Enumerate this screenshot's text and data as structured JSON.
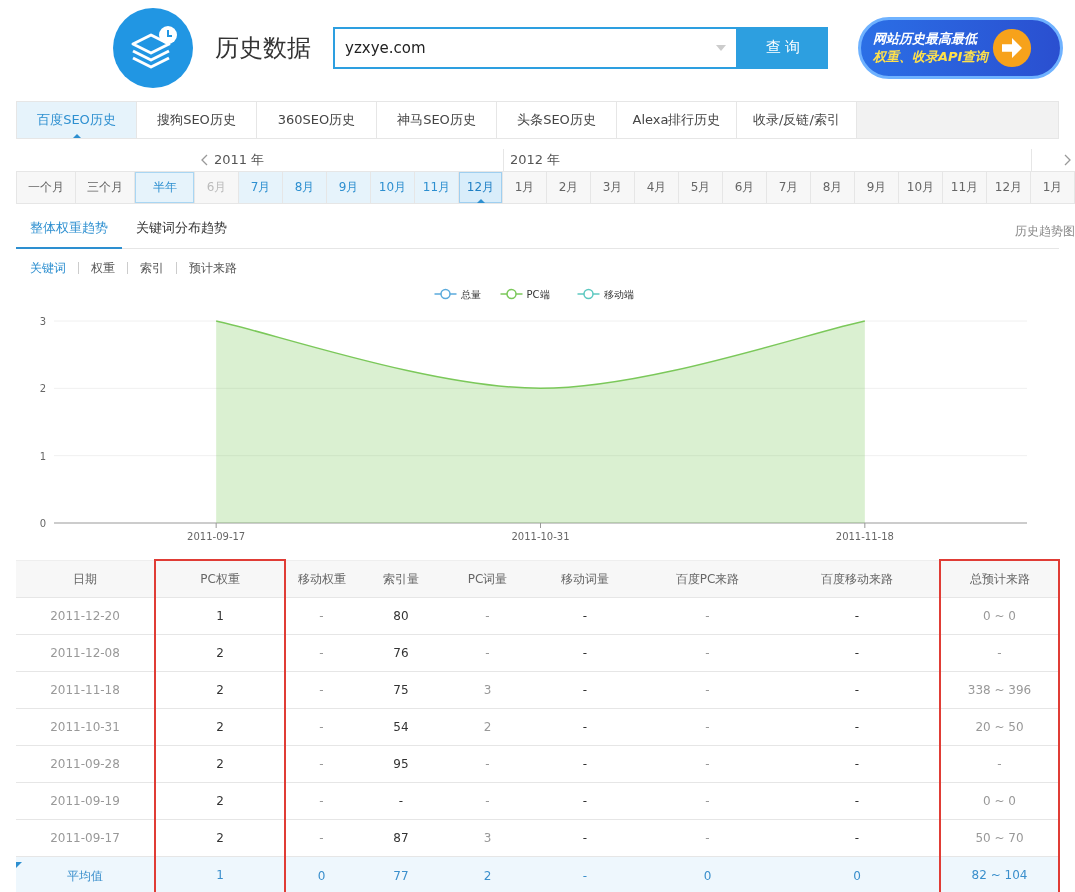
{
  "header": {
    "title": "历史数据",
    "search": {
      "value": "yzxye.com"
    },
    "search_button": "查 询",
    "banner": {
      "line_1": "网站历史最高最低",
      "line_2": "权重、收录API查询"
    }
  },
  "tabs": [
    {
      "label": "百度SEO历史",
      "selected": true
    },
    {
      "label": "搜狗SEO历史",
      "selected": false
    },
    {
      "label": "360SEO历史",
      "selected": false
    },
    {
      "label": "神马SEO历史",
      "selected": false
    },
    {
      "label": "头条SEO历史",
      "selected": false
    },
    {
      "label": "Alexa排行历史",
      "selected": false
    },
    {
      "label": "收录/反链/索引",
      "selected": false
    }
  ],
  "presets": [
    {
      "label": "一个月",
      "selected": false
    },
    {
      "label": "三个月",
      "selected": false
    },
    {
      "label": "半年",
      "selected": true
    }
  ],
  "years": [
    {
      "year": "2011 年",
      "months": [
        {
          "label": "6月",
          "disabled": true,
          "in_range": false,
          "selected": false
        },
        {
          "label": "7月",
          "disabled": false,
          "in_range": true,
          "selected": false
        },
        {
          "label": "8月",
          "disabled": false,
          "in_range": true,
          "selected": false
        },
        {
          "label": "9月",
          "disabled": false,
          "in_range": true,
          "selected": false
        },
        {
          "label": "10月",
          "disabled": false,
          "in_range": true,
          "selected": false
        },
        {
          "label": "11月",
          "disabled": false,
          "in_range": true,
          "selected": false
        },
        {
          "label": "12月",
          "disabled": false,
          "in_range": true,
          "selected": true
        }
      ]
    },
    {
      "year": "2012 年",
      "months": [
        {
          "label": "1月",
          "disabled": false,
          "in_range": false,
          "selected": false
        },
        {
          "label": "2月",
          "disabled": false,
          "in_range": false,
          "selected": false
        },
        {
          "label": "3月",
          "disabled": false,
          "in_range": false,
          "selected": false
        },
        {
          "label": "4月",
          "disabled": false,
          "in_range": false,
          "selected": false
        },
        {
          "label": "5月",
          "disabled": false,
          "in_range": false,
          "selected": false
        },
        {
          "label": "6月",
          "disabled": false,
          "in_range": false,
          "selected": false
        },
        {
          "label": "7月",
          "disabled": false,
          "in_range": false,
          "selected": false
        },
        {
          "label": "8月",
          "disabled": false,
          "in_range": false,
          "selected": false
        },
        {
          "label": "9月",
          "disabled": false,
          "in_range": false,
          "selected": false
        },
        {
          "label": "10月",
          "disabled": false,
          "in_range": false,
          "selected": false
        },
        {
          "label": "11月",
          "disabled": false,
          "in_range": false,
          "selected": false
        },
        {
          "label": "12月",
          "disabled": false,
          "in_range": false,
          "selected": false
        }
      ]
    },
    {
      "months": [
        {
          "label": "1月",
          "disabled": false,
          "in_range": false,
          "selected": false
        }
      ]
    }
  ],
  "trend_tabs": [
    {
      "label": "整体权重趋势",
      "selected": true
    },
    {
      "label": "关键词分布趋势",
      "selected": false
    }
  ],
  "trend_link": "历史趋势图",
  "filters": [
    {
      "label": "关键词",
      "selected": true
    },
    {
      "label": "权重",
      "selected": false
    },
    {
      "label": "索引",
      "selected": false
    },
    {
      "label": "预计来路",
      "selected": false
    }
  ],
  "chart_data": {
    "type": "area",
    "categories": [
      "2011-09-17",
      "2011-10-31",
      "2011-11-18"
    ],
    "series": [
      {
        "name": "总量",
        "color": "#5aaadc",
        "values": [
          null,
          null,
          null
        ]
      },
      {
        "name": "PC端",
        "color": "#7bc85a",
        "values": [
          3,
          2,
          3
        ]
      },
      {
        "name": "移动端",
        "color": "#5cc8c0",
        "values": [
          null,
          null,
          null
        ]
      }
    ],
    "ylim": [
      0,
      3
    ],
    "yticks": [
      0,
      1,
      2,
      3
    ]
  },
  "table": {
    "columns": [
      {
        "label": "日期",
        "highlighted": false
      },
      {
        "label": "PC权重",
        "highlighted": true
      },
      {
        "label": "移动权重",
        "highlighted": false
      },
      {
        "label": "索引量",
        "highlighted": false
      },
      {
        "label": "PC词量",
        "highlighted": false
      },
      {
        "label": "移动词量",
        "highlighted": false
      },
      {
        "label": "百度PC来路",
        "highlighted": false
      },
      {
        "label": "百度移动来路",
        "highlighted": false
      },
      {
        "label": "总预计来路",
        "highlighted": true
      }
    ],
    "rows": [
      [
        "2011-12-20",
        "1",
        "-",
        "80",
        "-",
        "-",
        "-",
        "-",
        "0 ~ 0"
      ],
      [
        "2011-12-08",
        "2",
        "-",
        "76",
        "-",
        "-",
        "-",
        "-",
        "-"
      ],
      [
        "2011-11-18",
        "2",
        "-",
        "75",
        "3",
        "-",
        "-",
        "-",
        "338 ~ 396"
      ],
      [
        "2011-10-31",
        "2",
        "-",
        "54",
        "2",
        "-",
        "-",
        "-",
        "20 ~ 50"
      ],
      [
        "2011-09-28",
        "2",
        "-",
        "95",
        "-",
        "-",
        "-",
        "-",
        "-"
      ],
      [
        "2011-09-19",
        "2",
        "-",
        "-",
        "-",
        "-",
        "-",
        "-",
        "0 ~ 0"
      ],
      [
        "2011-09-17",
        "2",
        "-",
        "87",
        "3",
        "-",
        "-",
        "-",
        "50 ~ 70"
      ]
    ],
    "average_row": [
      "平均值",
      "1",
      "0",
      "77",
      "2",
      "-",
      "0",
      "0",
      "82 ~ 104"
    ]
  }
}
